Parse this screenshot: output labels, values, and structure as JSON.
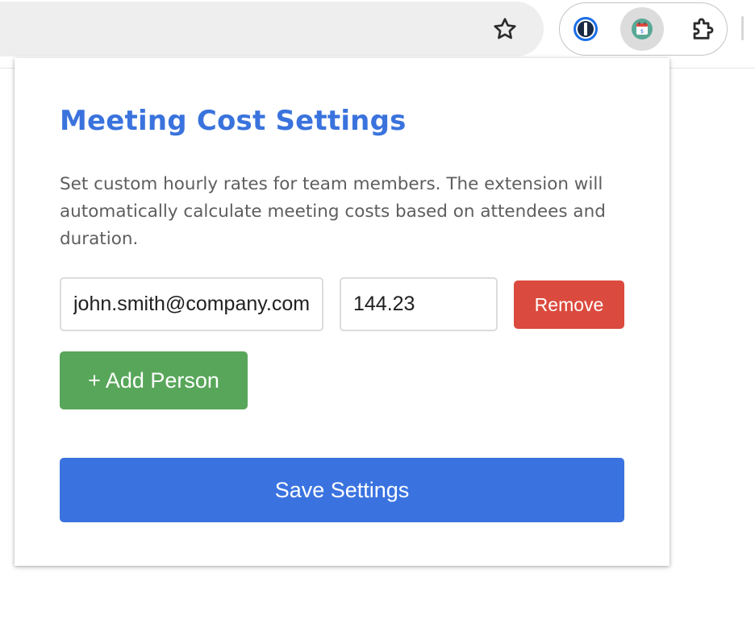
{
  "browser": {
    "toolbar_icons": [
      "bookmark-star-icon",
      "password-manager-icon",
      "calendar-extension-icon",
      "extensions-puzzle-icon"
    ]
  },
  "popup": {
    "title": "Meeting Cost Settings",
    "description": "Set custom hourly rates for team members. The extension will automatically calculate meeting costs based on attendees and duration.",
    "people": [
      {
        "email": "john.smith@company.com",
        "rate": "144.23",
        "remove_label": "Remove"
      }
    ],
    "add_person_label": "+ Add Person",
    "save_label": "Save Settings"
  },
  "colors": {
    "title": "#3a73dd",
    "remove_button": "#db4a3e",
    "add_button": "#58a65a",
    "save_button": "#3a73e0"
  }
}
